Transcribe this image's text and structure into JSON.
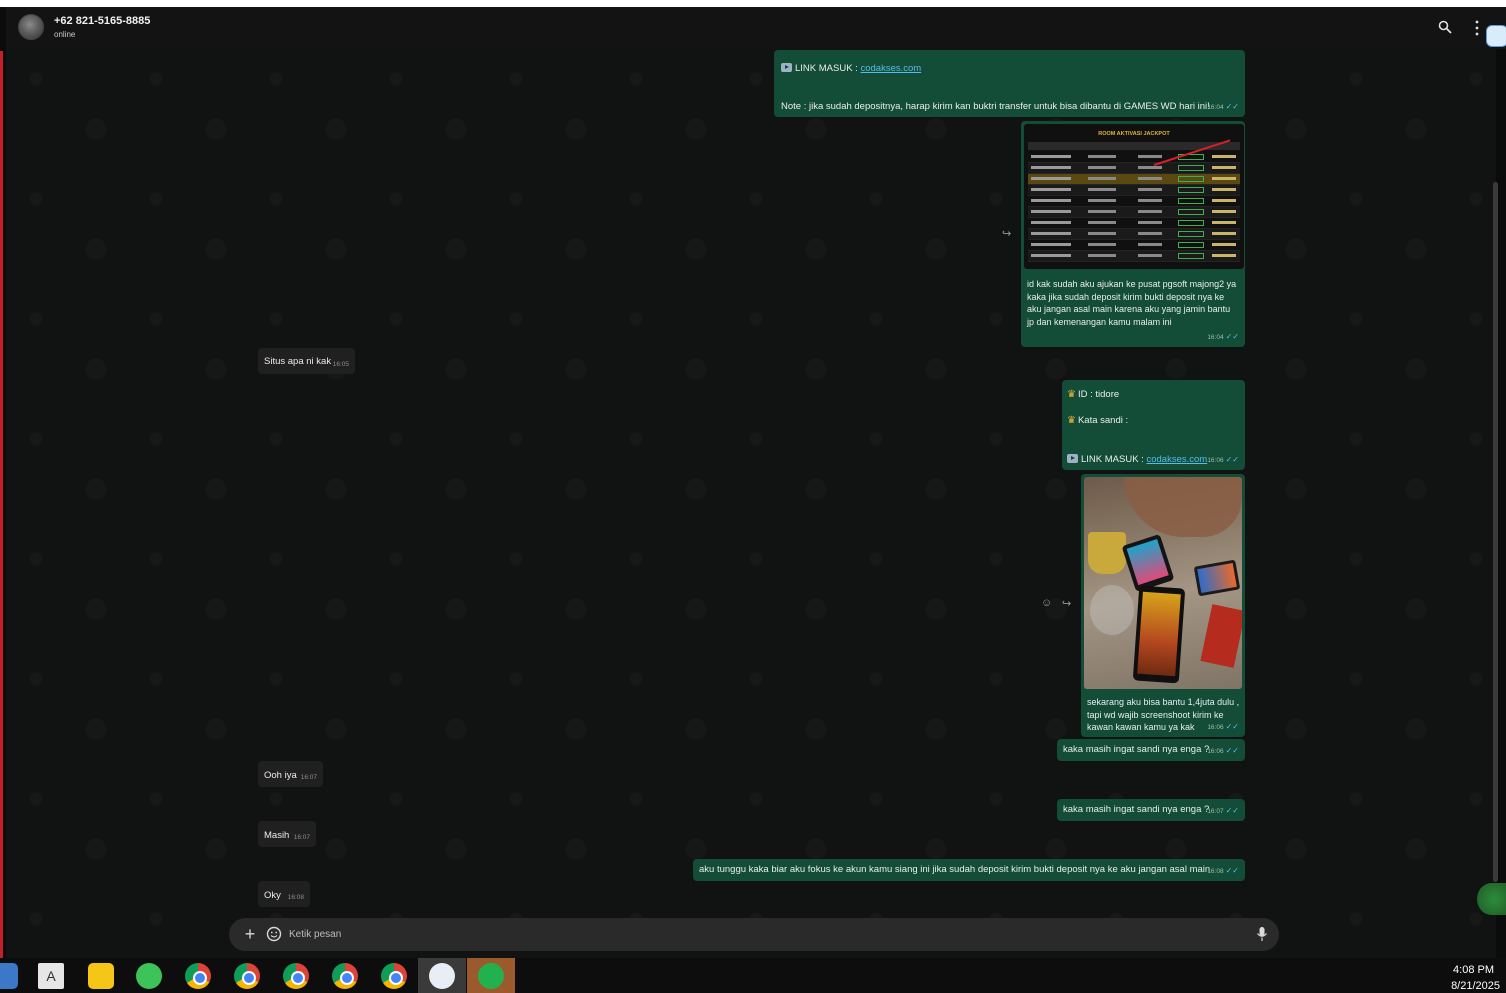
{
  "contact": {
    "name": "+62 821-5165-8885",
    "status": "online"
  },
  "messages": {
    "m1": {
      "link_label": "LINK MASUK : ",
      "link_text": "codakses.com",
      "note": "Note : jika sudah depositnya, harap kirim kan buktri transfer untuk bisa dibantu di GAMES WD hari ini!",
      "time": "16:04"
    },
    "m2": {
      "image_title": "ROOM AKTIVASI JACKPOT",
      "caption": "id kak sudah aku ajukan ke pusat pgsoft majong2 ya kaka jika sudah deposit kirim bukti deposit nya ke aku jangan asal main karena aku yang jamin bantu jp dan kemenangan kamu malam ini",
      "time": "16:04"
    },
    "m3": {
      "text": "Situs apa ni kak",
      "time": "16:05"
    },
    "m4": {
      "id_label": "ID :  tidore",
      "sandi_label": "Kata sandi :",
      "link_label": "LINK MASUK : ",
      "link_text": "codakses.com",
      "time": "16:06"
    },
    "m5": {
      "caption": "sekarang aku bisa bantu 1,4juta dulu , tapi wd wajib screenshoot kirim ke kawan kawan kamu ya kak",
      "time": "16:06"
    },
    "m6": {
      "text": "kaka masih ingat sandi nya enga ?",
      "time": "16:06"
    },
    "m7": {
      "text": "Ooh iya",
      "time": "16:07"
    },
    "m8": {
      "text": "kaka masih ingat sandi nya enga ?",
      "time": "16:07"
    },
    "m9": {
      "text": "Masih",
      "time": "16:07"
    },
    "m10": {
      "text": "aku tunggu kaka biar aku fokus ke akun kamu siang ini jika sudah deposit kirim bukti deposit nya ke aku jangan asal main",
      "time": "16:08"
    },
    "m11": {
      "text": "Oky",
      "time": "16:08"
    }
  },
  "composer": {
    "placeholder": "Ketik pesan"
  },
  "taskbar": {
    "time": "4:08 PM",
    "date": "8/21/2025"
  },
  "colors": {
    "outgoing": "#144d37",
    "incoming": "#202020",
    "link": "#53bdeb",
    "background": "#111312"
  }
}
